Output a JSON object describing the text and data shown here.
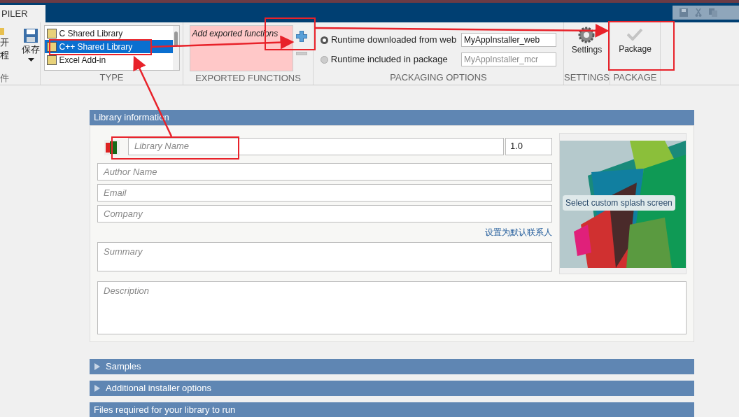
{
  "app_tab": {
    "label": "PILER",
    "selected": true
  },
  "file_section": {
    "open_lines": [
      "开",
      "程"
    ],
    "save": "保存",
    "label": "件"
  },
  "type_section": {
    "label": "TYPE",
    "items": [
      {
        "label": "C Shared Library",
        "selected": false
      },
      {
        "label": "C++ Shared Library",
        "selected": true
      },
      {
        "label": "Excel Add-in",
        "selected": false
      }
    ]
  },
  "exported_functions": {
    "placeholder": "Add exported functions",
    "label": "EXPORTED FUNCTIONS"
  },
  "packaging_options": {
    "label": "PACKAGING OPTIONS",
    "options": [
      {
        "label": "Runtime downloaded from web",
        "value": "MyAppInstaller_web",
        "selected": true
      },
      {
        "label": "Runtime included in package",
        "value": "MyAppInstaller_mcr",
        "selected": false
      }
    ]
  },
  "settings": {
    "button": "Settings",
    "label": "SETTINGS"
  },
  "package": {
    "button": "Package",
    "label": "PACKAGE"
  },
  "library_information": {
    "title": "Library information",
    "name_placeholder": "Library Name",
    "version": "1.0",
    "fields": [
      {
        "placeholder": "Author Name"
      },
      {
        "placeholder": "Email"
      },
      {
        "placeholder": "Company"
      }
    ],
    "default_contact_link": "设置为默认联系人",
    "summary_placeholder": "Summary",
    "description_placeholder": "Description",
    "splash_button": "Select custom splash screen"
  },
  "sections": [
    {
      "title": "Samples",
      "expanded": false,
      "kind": "collapsible"
    },
    {
      "title": "Additional installer options",
      "expanded": false,
      "kind": "collapsible"
    },
    {
      "title": "Files required for your library to run",
      "kind": "plain"
    }
  ]
}
